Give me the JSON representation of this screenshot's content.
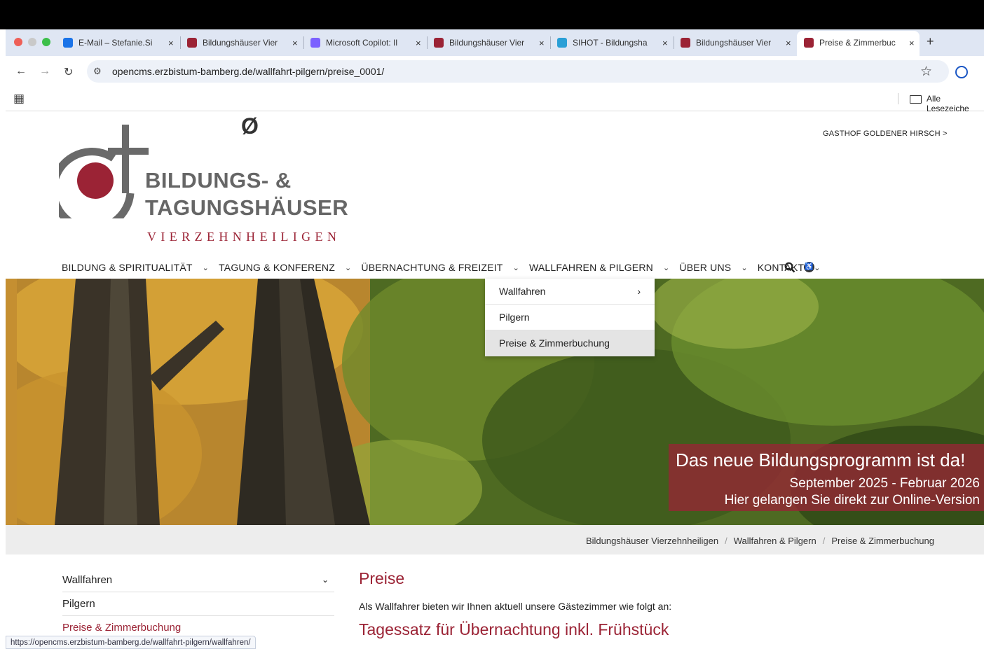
{
  "browser": {
    "tabs": [
      {
        "title": "E-Mail – Stefanie.Si",
        "favicon_color": "#1a73e8",
        "active": false
      },
      {
        "title": "Bildungshäuser Vier",
        "favicon_color": "#9b2335",
        "active": false
      },
      {
        "title": "Microsoft Copilot: Il",
        "favicon_color": "#7b61ff",
        "active": false
      },
      {
        "title": "Bildungshäuser Vier",
        "favicon_color": "#9b2335",
        "active": false
      },
      {
        "title": "SIHOT - Bildungsha",
        "favicon_color": "#2a9fd6",
        "active": false
      },
      {
        "title": "Bildungshäuser Vier",
        "favicon_color": "#9b2335",
        "active": false
      },
      {
        "title": "Preise & Zimmerbuc",
        "favicon_color": "#9b2335",
        "active": true
      }
    ],
    "new_tab_label": "+",
    "close_glyph": "×",
    "url": "opencms.erzbistum-bamberg.de/wallfahrt-pilgern/preise_0001/",
    "bookmarks_label": "Alle Lesezeiche",
    "status_url": "https://opencms.erzbistum-bamberg.de/wallfahrt-pilgern/wallfahren/",
    "icons": {
      "back": "←",
      "forward": "→",
      "reload": "↻",
      "tune": "⚙",
      "star": "☆",
      "apps": "▦",
      "folder": "folder-icon"
    }
  },
  "site": {
    "header_link": "GASTHOF GOLDENER HIRSCH >",
    "access_symbol": "Ø",
    "logo": {
      "line1": "BILDUNGS- &",
      "line2": "TAGUNGSHÄUSER",
      "line3": "VIERZEHNHEILIGEN",
      "brand_red": "#9b2335",
      "brand_grey": "#666666"
    },
    "nav": [
      {
        "label": "BILDUNG & SPIRITUALITÄT"
      },
      {
        "label": "TAGUNG & KONFERENZ"
      },
      {
        "label": "ÜBERNACHTUNG & FREIZEIT"
      },
      {
        "label": "WALLFAHREN & PILGERN"
      },
      {
        "label": "ÜBER UNS"
      },
      {
        "label": "KONTAKT"
      }
    ],
    "nav_chevron": "⌄",
    "dropdown": [
      {
        "label": "Wallfahren",
        "arrow": "›"
      },
      {
        "label": "Pilgern",
        "arrow": ""
      },
      {
        "label": "Preise & Zimmerbuchung",
        "arrow": ""
      }
    ],
    "promo": {
      "title": "Das neue Bildungsprogramm ist da!",
      "period": "September 2025 - Februar 2026",
      "link": "Hier gelangen Sie direkt zur Online-Version"
    },
    "breadcrumb": [
      "Bildungshäuser Vierzehnheiligen",
      "Wallfahren & Pilgern",
      "Preise & Zimmerbuchung"
    ],
    "breadcrumb_sep": "/",
    "sidebar": [
      {
        "label": "Wallfahren",
        "chevron": "⌄"
      },
      {
        "label": "Pilgern",
        "chevron": ""
      },
      {
        "label": "Preise & Zimmerbuchung",
        "chevron": ""
      }
    ],
    "content": {
      "heading": "Preise",
      "intro": "Als Wallfahrer bieten wir Ihnen aktuell unsere Gästezimmer wie folgt an:",
      "subheading": "Tagessatz für Übernachtung inkl. Frühstück"
    }
  }
}
